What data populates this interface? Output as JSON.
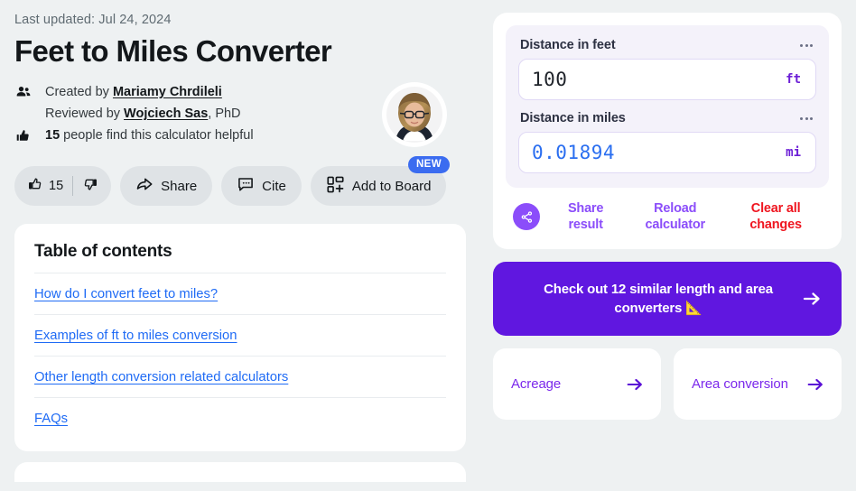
{
  "header": {
    "last_updated": "Last updated: Jul 24, 2024",
    "title": "Feet to Miles Converter",
    "created_by_prefix": "Created by",
    "created_by_name": "Mariamy Chrdileli",
    "reviewed_by_prefix": "Reviewed by",
    "reviewed_by_name": "Wojciech Sas",
    "reviewed_by_suffix": ", PhD",
    "helpful_count": "15",
    "helpful_text": "people find this calculator helpful",
    "people_icon": "people-icon",
    "thumbs_up_icon": "thumbs-up-icon",
    "avatar_alt": "author-avatar"
  },
  "actions": {
    "upvote_count": "15",
    "upvote_icon": "thumbs-up-icon",
    "downvote_icon": "thumbs-down-icon",
    "share_label": "Share",
    "share_icon": "share-arrow-icon",
    "cite_label": "Cite",
    "cite_icon": "quote-bubble-icon",
    "add_to_board_label": "Add to Board",
    "add_to_board_icon": "board-grid-plus-icon",
    "new_badge": "NEW"
  },
  "toc": {
    "title": "Table of contents",
    "items": [
      {
        "label": "How do I convert feet to miles?"
      },
      {
        "label": "Examples of ft to miles conversion"
      },
      {
        "label": "Other length conversion related calculators"
      },
      {
        "label": "FAQs"
      }
    ]
  },
  "calculator": {
    "fields": [
      {
        "label": "Distance in feet",
        "value": "100",
        "unit": "ft",
        "placeholder": "Distance in feet",
        "menu_icon": "ellipsis-icon",
        "active": false
      },
      {
        "label": "Distance in miles",
        "value": "0.01894",
        "unit": "mi",
        "placeholder": "Distance in miles",
        "menu_icon": "ellipsis-icon",
        "active": true
      }
    ],
    "share_result_label": "Share result",
    "share_result_icon": "share-nodes-icon",
    "reload_label": "Reload calculator",
    "clear_label": "Clear all changes",
    "clear_color": "#ef1620",
    "accent_color": "#8b4dfa"
  },
  "cta": {
    "text": "Check out 12 similar length and area converters 📐",
    "arrow_icon": "arrow-right-icon",
    "background": "#6017e0"
  },
  "related": [
    {
      "label": "Acreage",
      "arrow_icon": "arrow-right-icon"
    },
    {
      "label": "Area conversion",
      "arrow_icon": "arrow-right-icon"
    }
  ]
}
